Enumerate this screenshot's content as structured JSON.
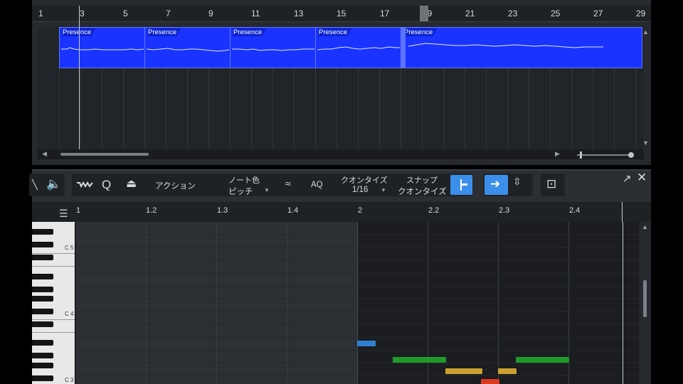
{
  "arrange": {
    "ruler_ticks": [
      "1",
      "3",
      "5",
      "7",
      "9",
      "11",
      "13",
      "15",
      "17",
      "19",
      "21",
      "23",
      "25",
      "27",
      "29"
    ],
    "clips": [
      {
        "label": "Presence"
      },
      {
        "label": "Presence"
      },
      {
        "label": "Presence"
      },
      {
        "label": "Presence"
      },
      {
        "label": "Presence"
      }
    ]
  },
  "toolbar": {
    "action_label": "アクション",
    "note_color_title": "ノート色",
    "note_color_value": "ピッチ",
    "aq_label": "AQ",
    "quantize_title": "クオンタイズ",
    "quantize_value": "1/16",
    "snap_title": "スナップ",
    "snap_value": "クオンタイズ"
  },
  "piano": {
    "ruler_ticks": [
      "1",
      "1.2",
      "1.3",
      "1.4",
      "2",
      "2.2",
      "2.3",
      "2.4"
    ],
    "key_labels": [
      "C 5",
      "C 4",
      "C 3"
    ],
    "notes": [
      {
        "color": "#2f7fd1"
      },
      {
        "color": "#1f9a2a"
      },
      {
        "color": "#c9a12f"
      },
      {
        "color": "#1f9a2a"
      },
      {
        "color": "#c9a12f"
      },
      {
        "color": "#d93a1e"
      }
    ]
  },
  "colors": {
    "accent": "#3b8eea",
    "clip": "#1a33ff"
  }
}
